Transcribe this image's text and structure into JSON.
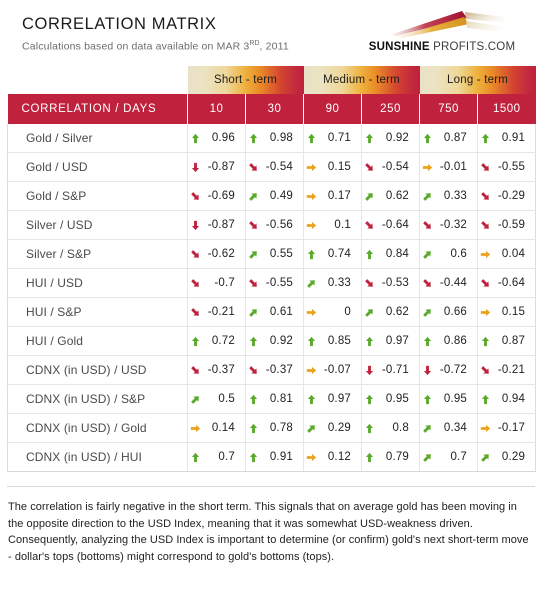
{
  "header": {
    "title": "CORRELATION MATRIX",
    "subtitle_prefix": "Calculations based on data available on",
    "date_month_day": "MAR 3",
    "date_ordinal": "RD",
    "date_year": ", 2011",
    "logo_bold": "SUNSHINE",
    "logo_rest": " PROFITS.COM",
    "logo_colors": {
      "crimson": "#b01c3a",
      "gold": "#e0a324",
      "cream": "#efe3c4"
    }
  },
  "table": {
    "corner_label": "CORRELATION / DAYS",
    "term_bands": [
      {
        "label": "Short - term",
        "span": 2
      },
      {
        "label": "Medium - term",
        "span": 2
      },
      {
        "label": "Long - term",
        "span": 2
      }
    ],
    "day_columns": [
      "10",
      "30",
      "90",
      "250",
      "750",
      "1500"
    ],
    "header_color": "#c0223e",
    "arrow_colors": {
      "up": "#5aaa2a",
      "down": "#c0223e",
      "flat": "#eda21d"
    },
    "rows": [
      {
        "label": "Gold / Silver",
        "cells": [
          {
            "value": "0.96",
            "arrow": "up"
          },
          {
            "value": "0.98",
            "arrow": "up"
          },
          {
            "value": "0.71",
            "arrow": "up"
          },
          {
            "value": "0.92",
            "arrow": "up"
          },
          {
            "value": "0.87",
            "arrow": "up"
          },
          {
            "value": "0.91",
            "arrow": "up"
          }
        ]
      },
      {
        "label": "Gold / USD",
        "cells": [
          {
            "value": "-0.87",
            "arrow": "down"
          },
          {
            "value": "-0.54",
            "arrow": "down-right"
          },
          {
            "value": "0.15",
            "arrow": "right"
          },
          {
            "value": "-0.54",
            "arrow": "down-right"
          },
          {
            "value": "-0.01",
            "arrow": "right"
          },
          {
            "value": "-0.55",
            "arrow": "down-right"
          }
        ]
      },
      {
        "label": "Gold / S&P",
        "cells": [
          {
            "value": "-0.69",
            "arrow": "down-right"
          },
          {
            "value": "0.49",
            "arrow": "up-right"
          },
          {
            "value": "0.17",
            "arrow": "right"
          },
          {
            "value": "0.62",
            "arrow": "up-right"
          },
          {
            "value": "0.33",
            "arrow": "up-right"
          },
          {
            "value": "-0.29",
            "arrow": "down-right"
          }
        ]
      },
      {
        "label": "Silver / USD",
        "cells": [
          {
            "value": "-0.87",
            "arrow": "down"
          },
          {
            "value": "-0.56",
            "arrow": "down-right"
          },
          {
            "value": "0.1",
            "arrow": "right"
          },
          {
            "value": "-0.64",
            "arrow": "down-right"
          },
          {
            "value": "-0.32",
            "arrow": "down-right"
          },
          {
            "value": "-0.59",
            "arrow": "down-right"
          }
        ]
      },
      {
        "label": "Silver / S&P",
        "cells": [
          {
            "value": "-0.62",
            "arrow": "down-right"
          },
          {
            "value": "0.55",
            "arrow": "up-right"
          },
          {
            "value": "0.74",
            "arrow": "up"
          },
          {
            "value": "0.84",
            "arrow": "up"
          },
          {
            "value": "0.6",
            "arrow": "up-right"
          },
          {
            "value": "0.04",
            "arrow": "right"
          }
        ]
      },
      {
        "label": "HUI / USD",
        "cells": [
          {
            "value": "-0.7",
            "arrow": "down-right"
          },
          {
            "value": "-0.55",
            "arrow": "down-right"
          },
          {
            "value": "0.33",
            "arrow": "up-right"
          },
          {
            "value": "-0.53",
            "arrow": "down-right"
          },
          {
            "value": "-0.44",
            "arrow": "down-right"
          },
          {
            "value": "-0.64",
            "arrow": "down-right"
          }
        ]
      },
      {
        "label": "HUI / S&P",
        "cells": [
          {
            "value": "-0.21",
            "arrow": "down-right"
          },
          {
            "value": "0.61",
            "arrow": "up-right"
          },
          {
            "value": "0",
            "arrow": "right"
          },
          {
            "value": "0.62",
            "arrow": "up-right"
          },
          {
            "value": "0.66",
            "arrow": "up-right"
          },
          {
            "value": "0.15",
            "arrow": "right"
          }
        ]
      },
      {
        "label": "HUI / Gold",
        "cells": [
          {
            "value": "0.72",
            "arrow": "up"
          },
          {
            "value": "0.92",
            "arrow": "up"
          },
          {
            "value": "0.85",
            "arrow": "up"
          },
          {
            "value": "0.97",
            "arrow": "up"
          },
          {
            "value": "0.86",
            "arrow": "up"
          },
          {
            "value": "0.87",
            "arrow": "up"
          }
        ]
      },
      {
        "label": "CDNX (in USD) / USD",
        "cells": [
          {
            "value": "-0.37",
            "arrow": "down-right"
          },
          {
            "value": "-0.37",
            "arrow": "down-right"
          },
          {
            "value": "-0.07",
            "arrow": "right"
          },
          {
            "value": "-0.71",
            "arrow": "down"
          },
          {
            "value": "-0.72",
            "arrow": "down"
          },
          {
            "value": "-0.21",
            "arrow": "down-right"
          }
        ]
      },
      {
        "label": "CDNX (in USD) / S&P",
        "cells": [
          {
            "value": "0.5",
            "arrow": "up-right"
          },
          {
            "value": "0.81",
            "arrow": "up"
          },
          {
            "value": "0.97",
            "arrow": "up"
          },
          {
            "value": "0.95",
            "arrow": "up"
          },
          {
            "value": "0.95",
            "arrow": "up"
          },
          {
            "value": "0.94",
            "arrow": "up"
          }
        ]
      },
      {
        "label": "CDNX (in USD) / Gold",
        "cells": [
          {
            "value": "0.14",
            "arrow": "right"
          },
          {
            "value": "0.78",
            "arrow": "up"
          },
          {
            "value": "0.29",
            "arrow": "up-right"
          },
          {
            "value": "0.8",
            "arrow": "up"
          },
          {
            "value": "0.34",
            "arrow": "up-right"
          },
          {
            "value": "-0.17",
            "arrow": "right"
          }
        ]
      },
      {
        "label": "CDNX (in USD) / HUI",
        "cells": [
          {
            "value": "0.7",
            "arrow": "up"
          },
          {
            "value": "0.91",
            "arrow": "up"
          },
          {
            "value": "0.12",
            "arrow": "right"
          },
          {
            "value": "0.79",
            "arrow": "up"
          },
          {
            "value": "0.7",
            "arrow": "up-right"
          },
          {
            "value": "0.29",
            "arrow": "up-right"
          }
        ]
      }
    ]
  },
  "footer": {
    "text": "The correlation is fairly negative in the short term. This signals that on average gold has been moving in the opposite direction to the USD Index, meaning that it was somewhat USD-weakness driven. Consequently, analyzing the USD Index is important to determine (or confirm) gold's next short-term move - dollar's tops (bottoms) might correspond to gold's bottoms (tops)."
  }
}
